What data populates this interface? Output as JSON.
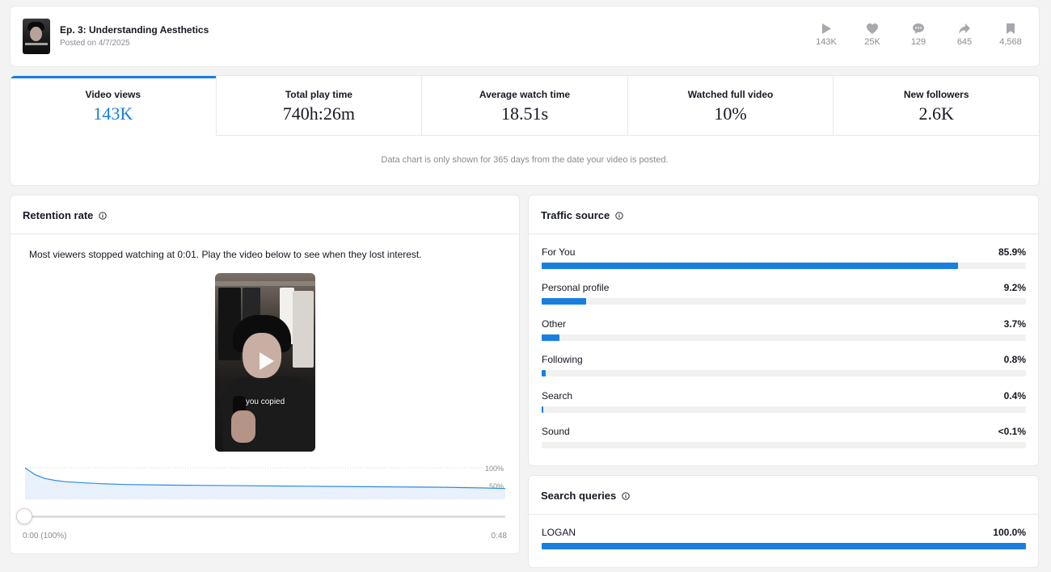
{
  "header": {
    "title": "Ep. 3: Understanding Aesthetics",
    "posted": "Posted on 4/7/2025",
    "stats": [
      {
        "icon": "play-icon",
        "value": "143K"
      },
      {
        "icon": "heart-icon",
        "value": "25K"
      },
      {
        "icon": "comment-icon",
        "value": "129"
      },
      {
        "icon": "share-icon",
        "value": "645"
      },
      {
        "icon": "bookmark-icon",
        "value": "4,568"
      }
    ]
  },
  "metrics": {
    "tabs": [
      {
        "label": "Video views",
        "value": "143K"
      },
      {
        "label": "Total play time",
        "value": "740h:26m"
      },
      {
        "label": "Average watch time",
        "value": "18.51s"
      },
      {
        "label": "Watched full video",
        "value": "10%"
      },
      {
        "label": "New followers",
        "value": "2.6K"
      }
    ],
    "note": "Data chart is only shown for 365 days from the date your video is posted."
  },
  "retention": {
    "title": "Retention rate",
    "message": "Most viewers stopped watching at 0:01. Play the video below to see when they lost interest.",
    "video_caption": "you copied",
    "label_100": "100%",
    "label_50": "50%",
    "time_start": "0:00 (100%)",
    "time_end": "0:48"
  },
  "chart_data": {
    "type": "area",
    "x": [
      0,
      1,
      2,
      3,
      4,
      6,
      8,
      10,
      14,
      18,
      22,
      26,
      30,
      34,
      38,
      42,
      46,
      48
    ],
    "y": [
      100,
      78,
      66,
      60,
      56,
      52,
      49,
      47,
      45,
      44,
      43,
      42,
      41,
      40,
      39,
      38,
      36,
      34
    ],
    "xlabel": "",
    "ylabel": "",
    "xlim": [
      0,
      48
    ],
    "ylim": [
      0,
      100
    ],
    "grid": true
  },
  "traffic": {
    "title": "Traffic source",
    "rows": [
      {
        "label": "For You",
        "pct": "85.9%",
        "value": 85.9
      },
      {
        "label": "Personal profile",
        "pct": "9.2%",
        "value": 9.2
      },
      {
        "label": "Other",
        "pct": "3.7%",
        "value": 3.7
      },
      {
        "label": "Following",
        "pct": "0.8%",
        "value": 0.8
      },
      {
        "label": "Search",
        "pct": "0.4%",
        "value": 0.4
      },
      {
        "label": "Sound",
        "pct": "<0.1%",
        "value": 0
      }
    ]
  },
  "search": {
    "title": "Search queries",
    "rows": [
      {
        "label": "LOGAN",
        "pct": "100.0%",
        "value": 100
      }
    ]
  },
  "colors": {
    "accent": "#1a7ee0",
    "track": "#f1f1f2",
    "muted_text": "#8a8b91"
  }
}
